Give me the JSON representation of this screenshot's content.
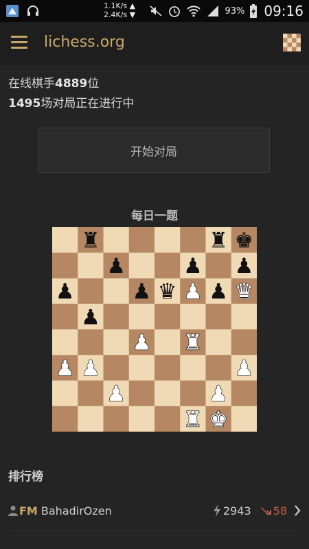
{
  "status_bar": {
    "net_up": "1.1K/s",
    "net_down": "2.4K/s",
    "battery": "93%",
    "time": "09:16"
  },
  "app": {
    "title": "lichess.org"
  },
  "home": {
    "players_prefix": "在线棋手",
    "players_count": "4889",
    "players_suffix": "位",
    "games_count": "1495",
    "games_suffix": "场对局正在进行中",
    "start_game_label": "开始对局"
  },
  "puzzle": {
    "title": "每日一题",
    "light_square": "#f0d9b5",
    "dark_square": "#b58863",
    "pieces": [
      {
        "sq": "b8",
        "p": "br"
      },
      {
        "sq": "g8",
        "p": "br"
      },
      {
        "sq": "h8",
        "p": "bk"
      },
      {
        "sq": "c7",
        "p": "bp"
      },
      {
        "sq": "f7",
        "p": "bp"
      },
      {
        "sq": "h7",
        "p": "bp"
      },
      {
        "sq": "a6",
        "p": "bp"
      },
      {
        "sq": "d6",
        "p": "bp"
      },
      {
        "sq": "e6",
        "p": "bq"
      },
      {
        "sq": "f6",
        "p": "wp"
      },
      {
        "sq": "g6",
        "p": "bp"
      },
      {
        "sq": "h6",
        "p": "wq"
      },
      {
        "sq": "b5",
        "p": "bp"
      },
      {
        "sq": "d4",
        "p": "wp"
      },
      {
        "sq": "f4",
        "p": "wr"
      },
      {
        "sq": "a3",
        "p": "wp"
      },
      {
        "sq": "b3",
        "p": "wp"
      },
      {
        "sq": "h3",
        "p": "wp"
      },
      {
        "sq": "c2",
        "p": "wp"
      },
      {
        "sq": "g2",
        "p": "wp"
      },
      {
        "sq": "f1",
        "p": "wr"
      },
      {
        "sq": "g1",
        "p": "wk"
      }
    ]
  },
  "leaderboard": {
    "title": "排行榜",
    "entries": [
      {
        "badge": "FM",
        "name": "BahadirOzen",
        "rating": "2943",
        "delta": "58",
        "delta_color": "#c85c48"
      }
    ]
  },
  "colors": {
    "accent": "#c8a868",
    "background": "#242424",
    "status_bar": "#0a0a0a"
  }
}
